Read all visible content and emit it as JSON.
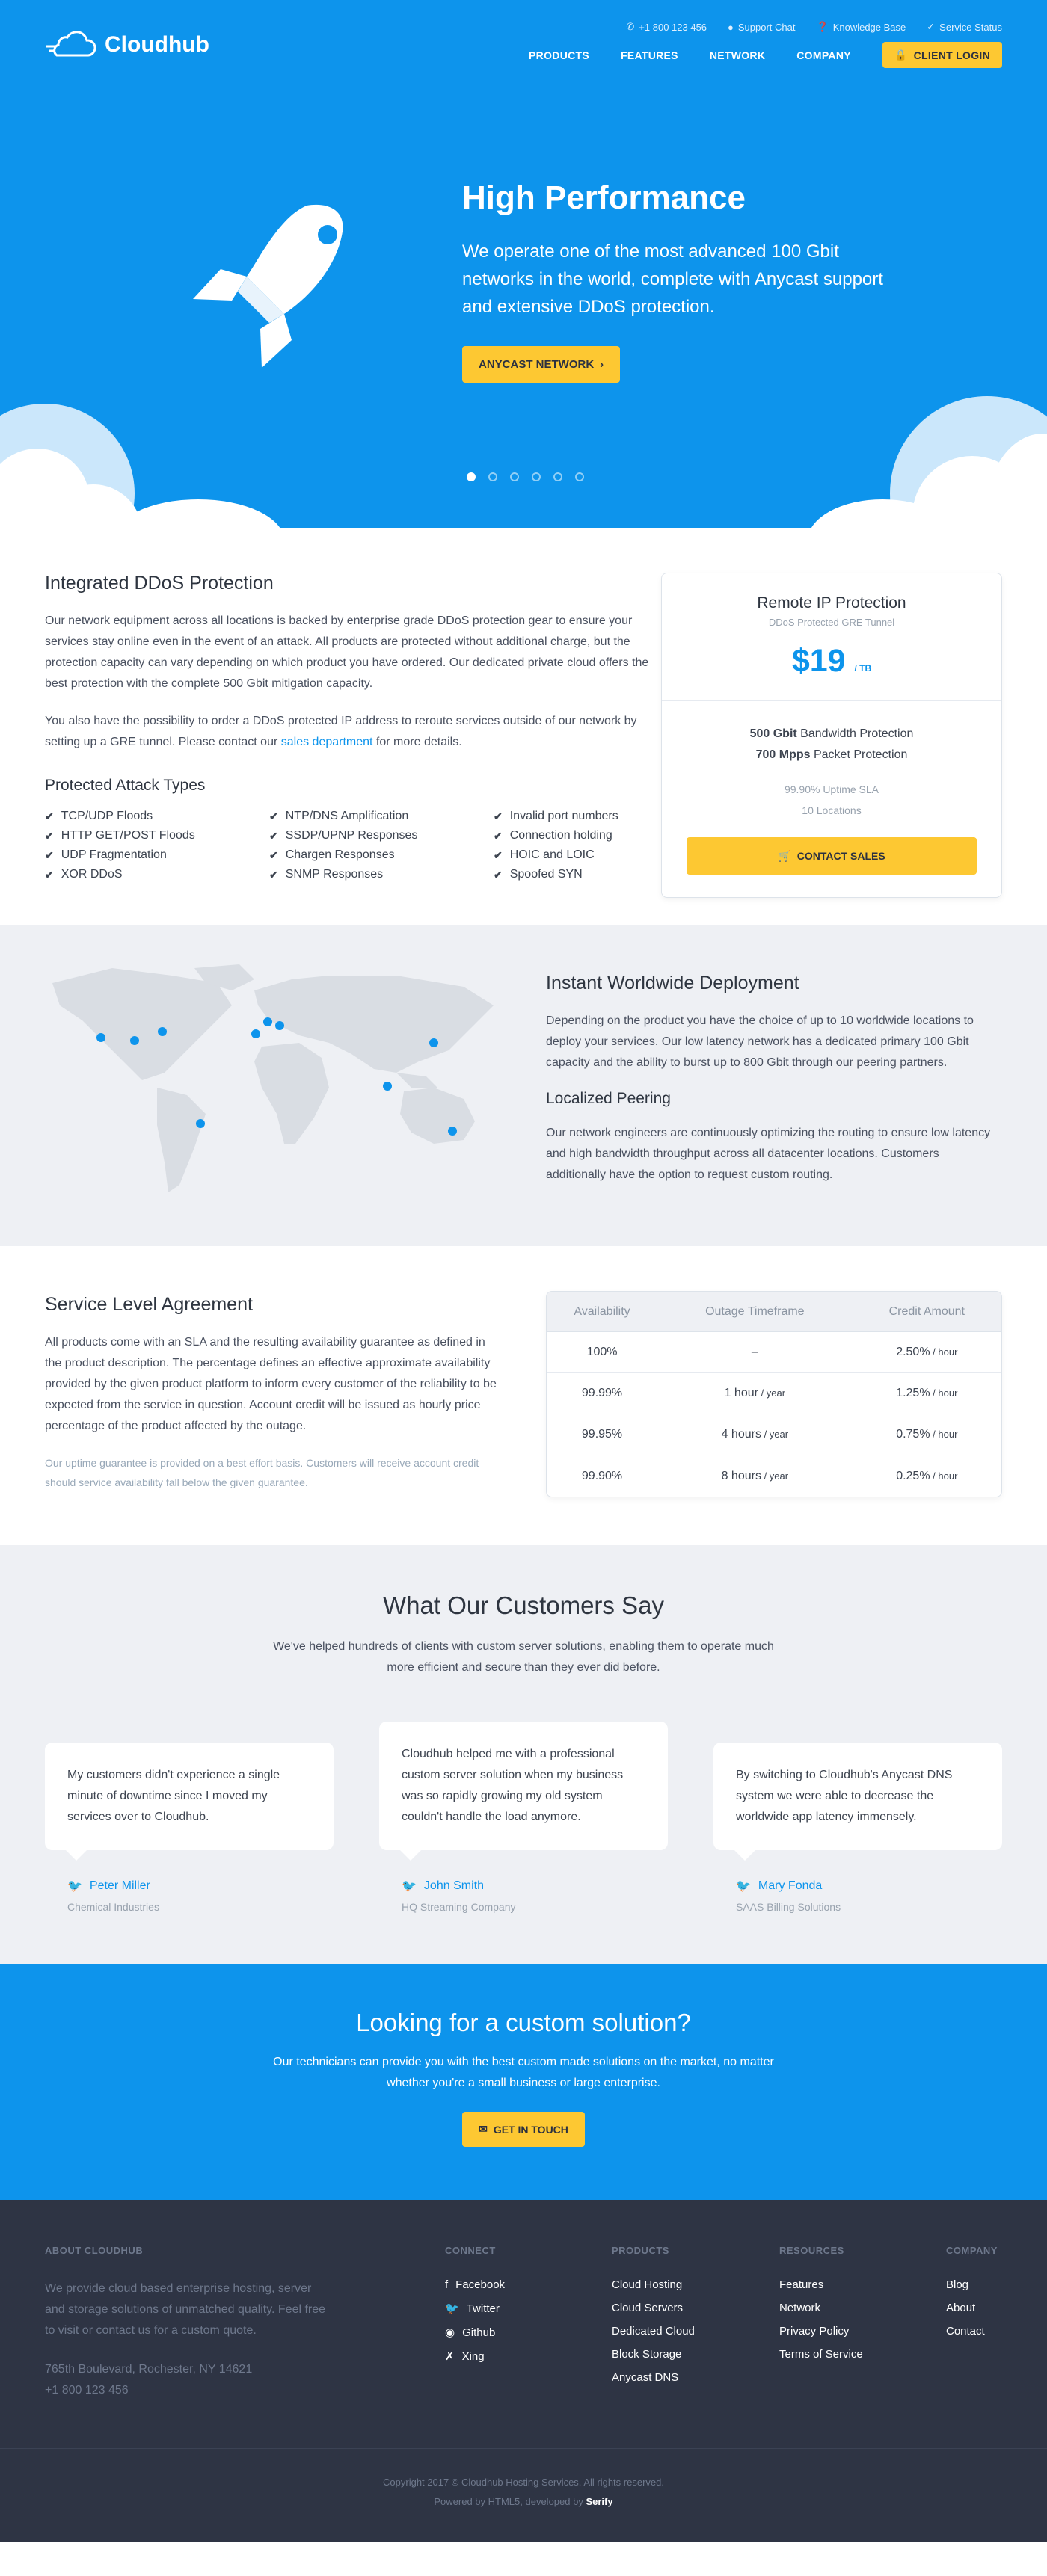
{
  "brand": {
    "name": "Cloudhub"
  },
  "topbar": {
    "phone": "+1 800 123 456",
    "support": "Support Chat",
    "kb": "Knowledge Base",
    "status": "Service Status"
  },
  "nav": {
    "items": [
      "PRODUCTS",
      "FEATURES",
      "NETWORK",
      "COMPANY"
    ],
    "login": "CLIENT LOGIN"
  },
  "hero": {
    "title": "High Performance",
    "text": "We operate one of the most advanced 100 Gbit networks in the world, complete with Anycast support and extensive DDoS protection.",
    "button": "ANYCAST NETWORK",
    "slides": 6,
    "active_slide": 1
  },
  "ddos": {
    "title": "Integrated DDoS Protection",
    "p1": "Our network equipment across all locations is backed by enterprise grade DDoS protection gear to ensure your services stay online even in the event of an attack. All products are protected without additional charge, but the protection capacity can vary depending on which product you have ordered. Our dedicated private cloud offers the best protection with the complete 500 Gbit mitigation capacity.",
    "p2_a": "You also have the possibility to order a DDoS protected IP address to reroute services outside of our network by setting up a GRE tunnel. Please contact our ",
    "p2_link": "sales department",
    "p2_b": " for more details.",
    "attacks_title": "Protected Attack Types",
    "attacks": [
      "TCP/UDP Floods",
      "NTP/DNS Amplification",
      "Invalid port numbers",
      "HTTP GET/POST Floods",
      "SSDP/UPNP Responses",
      "Connection holding",
      "UDP Fragmentation",
      "Chargen Responses",
      "HOIC and LOIC",
      "XOR DDoS",
      "SNMP Responses",
      "Spoofed SYN"
    ]
  },
  "pricing": {
    "title": "Remote IP Protection",
    "tagline": "DDoS Protected GRE Tunnel",
    "price": "$19",
    "unit": "/ TB",
    "bw_value": "500 Gbit",
    "bw_label": " Bandwidth Protection",
    "pp_value": "700 Mpps",
    "pp_label": " Packet Protection",
    "sla": "99.90% Uptime SLA",
    "locations": "10 Locations",
    "button": "CONTACT SALES"
  },
  "deploy": {
    "title": "Instant Worldwide Deployment",
    "text": "Depending on the product you have the choice of up to 10 worldwide locations to deploy your services. Our low latency network has a dedicated primary 100 Gbit capacity and the ability to burst up to 800 Gbit through our peering partners.",
    "peering_title": "Localized Peering",
    "peering_text": "Our network engineers are continuously optimizing the routing to ensure low latency and high bandwidth throughput across all datacenter locations. Customers additionally have the option to request custom routing."
  },
  "sla": {
    "title": "Service Level Agreement",
    "text": "All products come with an SLA and the resulting availability guarantee as defined in the product description. The percentage defines an effective approximate availability provided by the given product platform to inform every customer of the reliability to be expected from the service in question. Account credit will be issued as hourly price percentage of the product affected by the outage.",
    "note": "Our uptime guarantee is provided on a best effort basis. Customers will receive account credit should service availability fall below the given guarantee.",
    "headers": [
      "Availability",
      "Outage Timeframe",
      "Credit Amount"
    ],
    "rows": [
      {
        "avail": "100%",
        "outage": "–",
        "outage_unit": "",
        "credit": "2.50%",
        "credit_unit": " / hour"
      },
      {
        "avail": "99.99%",
        "outage": "1 hour",
        "outage_unit": " / year",
        "credit": "1.25%",
        "credit_unit": " / hour"
      },
      {
        "avail": "99.95%",
        "outage": "4 hours",
        "outage_unit": " / year",
        "credit": "0.75%",
        "credit_unit": " / hour"
      },
      {
        "avail": "99.90%",
        "outage": "8 hours",
        "outage_unit": " / year",
        "credit": "0.25%",
        "credit_unit": " / hour"
      }
    ]
  },
  "testimonials": {
    "title": "What Our Customers Say",
    "intro": "We've helped hundreds of clients with custom server solutions, enabling them to operate much more efficient and secure than they ever did before.",
    "items": [
      {
        "quote": "My customers didn't experience a single minute of downtime since I moved my services over to Cloudhub.",
        "name": "Peter Miller",
        "company": "Chemical Industries"
      },
      {
        "quote": "Cloudhub helped me with a professional custom server solution when my business was so rapidly growing my old system couldn't handle the load anymore.",
        "name": "John Smith",
        "company": "HQ Streaming Company"
      },
      {
        "quote": "By switching to Cloudhub's Anycast DNS system we were able to decrease the worldwide app latency immensely.",
        "name": "Mary Fonda",
        "company": "SAAS Billing Solutions"
      }
    ]
  },
  "cta": {
    "title": "Looking for a custom solution?",
    "text": "Our technicians can provide you with the best custom made solutions on the market, no matter whether you're a small business or large enterprise.",
    "button": "GET IN TOUCH"
  },
  "footer": {
    "about_title": "ABOUT CLOUDHUB",
    "about_text": "We provide cloud based enterprise hosting, server and storage solutions of unmatched quality. Feel free to visit or contact us for a custom quote.",
    "address": "765th Boulevard, Rochester, NY 14621",
    "phone": "+1 800 123 456",
    "connect_title": "CONNECT",
    "connect": [
      "Facebook",
      "Twitter",
      "Github",
      "Xing"
    ],
    "products_title": "PRODUCTS",
    "products": [
      "Cloud Hosting",
      "Cloud Servers",
      "Dedicated Cloud",
      "Block Storage",
      "Anycast DNS"
    ],
    "resources_title": "RESOURCES",
    "resources": [
      "Features",
      "Network",
      "Privacy Policy",
      "Terms of Service"
    ],
    "company_title": "COMPANY",
    "company": [
      "Blog",
      "About",
      "Contact"
    ],
    "copyright": "Copyright 2017 © Cloudhub Hosting Services. All rights reserved.",
    "powered": "Powered by HTML5, developed by ",
    "developer": "Serify"
  },
  "colors": {
    "primary": "#0d94ec",
    "accent": "#fdc832",
    "footer": "#2e3444",
    "light": "#eef0f4"
  }
}
